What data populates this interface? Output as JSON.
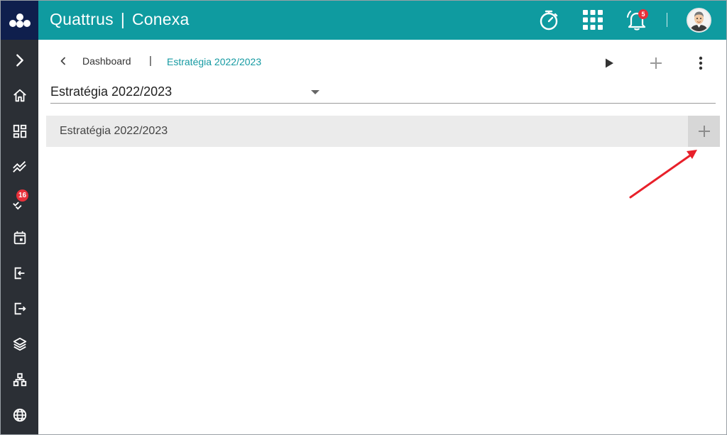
{
  "app": {
    "brand_left": "Quattrus",
    "brand_sep": "|",
    "brand_right": "Conexa"
  },
  "header": {
    "notifications_count": "5",
    "icons": [
      "timer-icon",
      "apps-grid-icon",
      "bell-icon",
      "avatar"
    ]
  },
  "sidebar": {
    "items": [
      {
        "icon": "chevron-right-icon"
      },
      {
        "icon": "home-icon"
      },
      {
        "icon": "dashboard-icon"
      },
      {
        "icon": "trend-icon"
      },
      {
        "icon": "tasks-icon",
        "badge": "16"
      },
      {
        "icon": "calendar-icon"
      },
      {
        "icon": "login-icon"
      },
      {
        "icon": "logout-icon"
      },
      {
        "icon": "layers-icon"
      },
      {
        "icon": "hierarchy-icon"
      },
      {
        "icon": "globe-icon"
      }
    ]
  },
  "breadcrumb": {
    "parent": "Dashboard",
    "separator": "|",
    "current": "Estratégia 2022/2023"
  },
  "selector": {
    "value": "Estratégia 2022/2023"
  },
  "panel": {
    "title": "Estratégia 2022/2023"
  },
  "colors": {
    "header": "#0f9ba0",
    "sidebar": "#2b2f35",
    "logo_bg": "#0f1f4d",
    "accent_text": "#159aa2",
    "badge": "#e8303a",
    "annotation": "#e8202a"
  }
}
